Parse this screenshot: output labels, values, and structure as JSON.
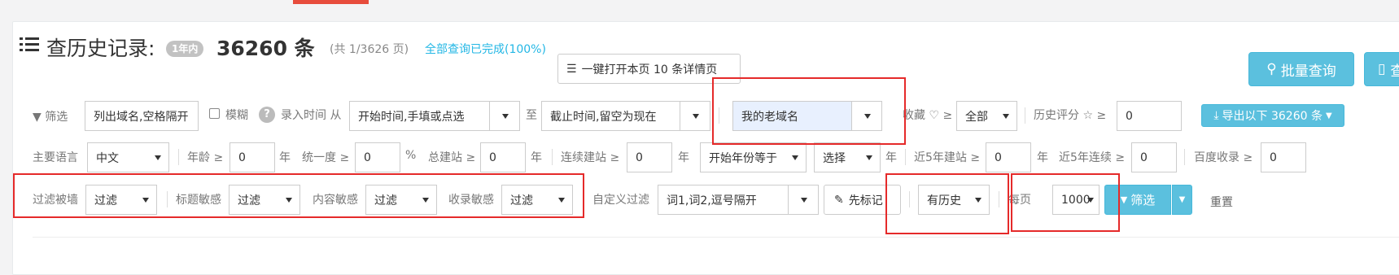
{
  "header": {
    "title": "查历史记录:",
    "badge": "1年内",
    "count": "36260 条",
    "pages": "(共 1/3626 页)",
    "status": "全部查询已完成(100%)",
    "open_all_button": "一键打开本页 10 条详情页",
    "batch_query_button": "批量查询",
    "query_button": "查"
  },
  "filters": {
    "filter_label": "筛选",
    "domain_placeholder": "列出域名,空格隔开",
    "fuzzy_label": "模糊",
    "entry_time_label": "录入时间 从",
    "start_time_placeholder": "开始时间,手填或点选",
    "to_label": "至",
    "end_time_placeholder": "截止时间,留空为现在",
    "domain_group_value": "我的老域名",
    "favorite_label": "收藏 ♡ ≥",
    "favorite_value": "全部",
    "history_score_label": "历史评分 ☆ ≥",
    "history_score_value": "0",
    "export_button": "导出以下 36260 条",
    "language_label": "主要语言",
    "language_value": "中文",
    "age_label": "年龄 ≥",
    "age_value": "0",
    "year_unit": "年",
    "consistency_label": "统一度 ≥",
    "consistency_value": "0",
    "percent_unit": "%",
    "total_sites_label": "总建站 ≥",
    "total_sites_value": "0",
    "continuous_label": "连续建站 ≥",
    "continuous_value": "0",
    "start_year_value": "开始年份等于",
    "choose_value": "选择",
    "recent5_label": "近5年建站 ≥",
    "recent5_value": "0",
    "recent5_cont_label": "近5年连续 ≥",
    "recent5_cont_value": "0",
    "baidu_label": "百度收录 ≥",
    "baidu_value": "0",
    "wall_label": "过滤被墙",
    "wall_value": "过滤",
    "title_sens_label": "标题敏感",
    "title_sens_value": "过滤",
    "content_sens_label": "内容敏感",
    "content_sens_value": "过滤",
    "index_sens_label": "收录敏感",
    "index_sens_value": "过滤",
    "custom_filter_label": "自定义过滤",
    "custom_filter_placeholder": "词1,词2,逗号隔开",
    "mark_button": "先标记",
    "history_value": "有历史",
    "per_page_label": "每页",
    "per_page_value": "1000",
    "filter_button": "筛选",
    "reset_button": "重置"
  },
  "colors": {
    "accent_blue": "#5bc0de",
    "link_blue": "#23b7e5",
    "highlight_red": "#e52a2a"
  }
}
